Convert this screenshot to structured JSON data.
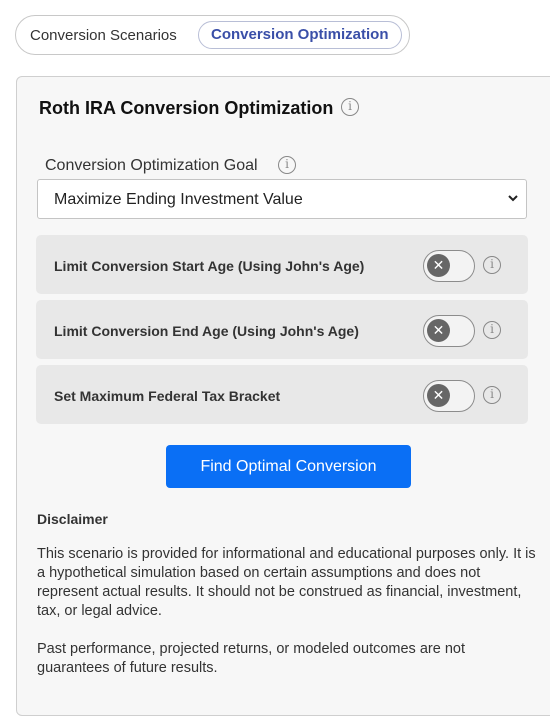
{
  "tabs": [
    {
      "label": "Conversion Scenarios",
      "active": false
    },
    {
      "label": "Conversion Optimization",
      "active": true
    }
  ],
  "panel": {
    "title": "Roth IRA Conversion Optimization",
    "goal_label": "Conversion Optimization Goal",
    "goal_value": "Maximize Ending Investment Value",
    "options": [
      {
        "label": "Limit Conversion Start Age (Using John's Age)",
        "enabled": false
      },
      {
        "label": "Limit Conversion End Age (Using John's Age)",
        "enabled": false
      },
      {
        "label": "Set Maximum Federal Tax Bracket",
        "enabled": false
      }
    ],
    "button_label": "Find Optimal Conversion",
    "disclaimer_title": "Disclaimer",
    "disclaimer_paragraphs": [
      "This scenario is provided for informational and educational purposes only. It is a hypothetical simulation based on certain assumptions and does not represent actual results. It should not be construed as financial, investment, tax, or legal advice.",
      "Past performance, projected returns, or modeled outcomes are not guarantees of future results."
    ]
  },
  "colors": {
    "accent": "#3a4fa8",
    "primary_button": "#0a6ff5",
    "row_background": "#e8e8e8",
    "panel_background": "#f7f7f7"
  },
  "icons": {
    "info": "info-circle-icon",
    "toggle_off": "close-icon",
    "dropdown": "chevron-down-icon"
  }
}
